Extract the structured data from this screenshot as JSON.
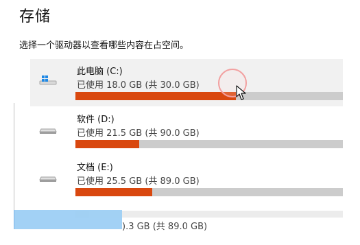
{
  "header": {
    "title": "存储",
    "description": "选择一个驱动器以查看哪些内容在占空间。"
  },
  "colors": {
    "selected_background": "#f1f1f1",
    "usage_fill": "#d9480f",
    "usage_track": "#cccccc",
    "blue_overlay": "#9fd0f5",
    "cursor_ring": "#f2a0a0"
  },
  "drives": [
    {
      "name": "此电脑 (C:)",
      "usage": "已使用 18.0 GB (共 30.0 GB)",
      "used_fraction": 0.6,
      "icon": "windows-drive-icon",
      "selected": true
    },
    {
      "name": "软件 (D:)",
      "usage": "已使用 21.5 GB (共 90.0 GB)",
      "used_fraction": 0.2389,
      "icon": "drive-icon",
      "selected": false
    },
    {
      "name": "文档 (E:)",
      "usage": "已使用 25.5 GB (共 89.0 GB)",
      "used_fraction": 0.2865,
      "icon": "drive-icon",
      "selected": false
    }
  ],
  "partial_row": {
    "usage_fragment": ").3 GB (共 89.0 GB)",
    "used_fraction": 0.05
  }
}
